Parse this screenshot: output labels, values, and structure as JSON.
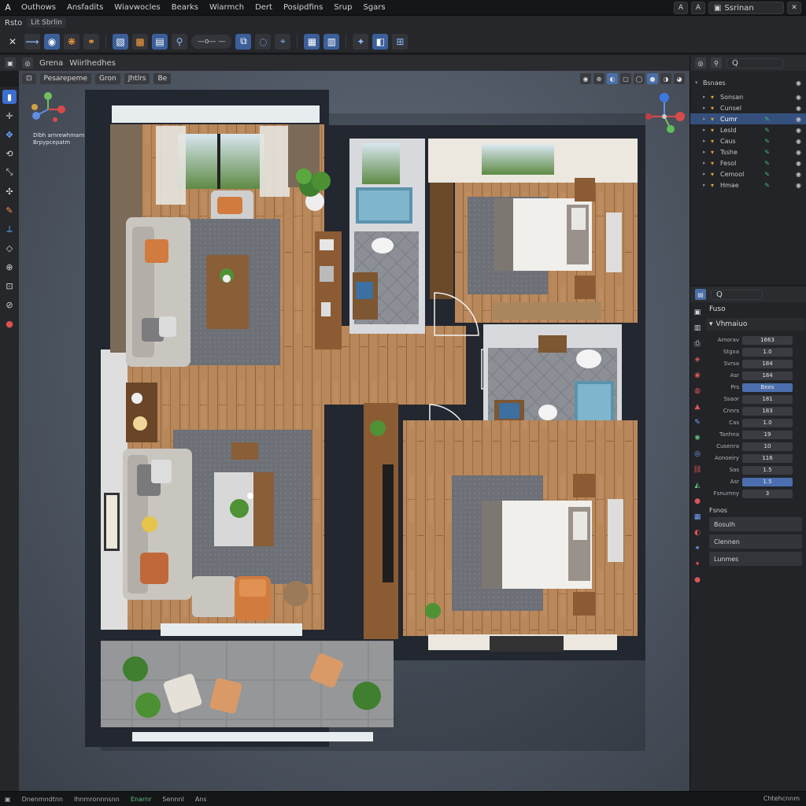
{
  "menubar": {
    "logo": "A",
    "items": [
      "Outhows",
      "Ansfadits",
      "Wiavwocles",
      "Bearks",
      "Wiarmch",
      "Dert",
      "Posipdfins",
      "Srup",
      "Sgars"
    ],
    "search_label": "Ssrinan",
    "btn_a": "A",
    "btn_b": "A"
  },
  "toolrow1": {
    "label": "Rsto",
    "chip": "Lit Sbrlin"
  },
  "toolrow2": {
    "pill_label": "—o— —"
  },
  "vp_header": {
    "items": [
      "Grena",
      "Wiirlhedhes"
    ],
    "chips": [
      "Pesarepeme",
      "Gron",
      "Jhtlrs",
      "Be"
    ]
  },
  "viewport": {
    "caption_line1": "Dlbh arnrewhmarn",
    "caption_line2": "Brpypcepatm"
  },
  "outliner": {
    "title": "Bsnaes",
    "search": "Q",
    "rows": [
      {
        "label": "Sonsan",
        "selected": false
      },
      {
        "label": "Cunsel",
        "selected": false
      },
      {
        "label": "Cumr",
        "selected": true
      },
      {
        "label": "Lesld",
        "selected": false
      },
      {
        "label": "Caus",
        "selected": false
      },
      {
        "label": "Tsshe",
        "selected": false
      },
      {
        "label": "Fesol",
        "selected": false
      },
      {
        "label": "Cemool",
        "selected": false
      },
      {
        "label": "Hmae",
        "selected": false
      }
    ]
  },
  "props": {
    "title": "Fuso",
    "search": "Q",
    "section": "Vhmaiuo",
    "fields": [
      {
        "label": "Amorav",
        "value": "1663"
      },
      {
        "label": "Stgxa",
        "value": "1.0"
      },
      {
        "label": "Svrsa",
        "value": "184"
      },
      {
        "label": "Asr",
        "value": "184"
      },
      {
        "label": "Prs",
        "value": "Bees",
        "selected": true
      },
      {
        "label": "Ssaor",
        "value": "181"
      },
      {
        "label": "Cnnrs",
        "value": "183"
      },
      {
        "label": "Cas",
        "value": "1.0"
      },
      {
        "label": "Tanhna",
        "value": "19"
      },
      {
        "label": "Cusenra",
        "value": "10"
      },
      {
        "label": "Aonoeiry",
        "value": "116"
      },
      {
        "label": "Sas",
        "value": "1.5"
      },
      {
        "label": "Asr",
        "value": "1.5",
        "selected": true
      },
      {
        "label": "Fsnurnny",
        "value": "3"
      }
    ],
    "subsection": "Fsnos",
    "buttons": [
      "Bosulh",
      "Clennen",
      "Lunmes"
    ]
  },
  "statusbar": {
    "items": [
      "Dnenmndtnn",
      "Ihnmronnnsnn",
      "Enarnr",
      "Sennnl",
      "Ans"
    ],
    "right": "Chtehcnnm"
  },
  "colors": {
    "accent": "#4b6fae",
    "wall": "#23272f",
    "floor": "#b8875a",
    "tile": "#8b8f95",
    "rug": "#6e7177"
  }
}
